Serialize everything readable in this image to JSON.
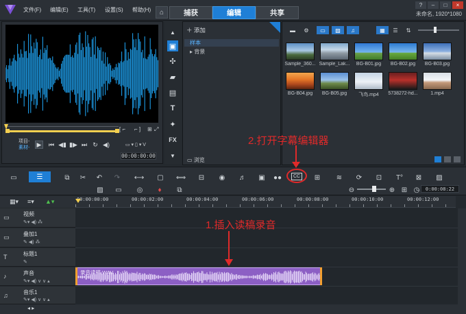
{
  "menu": {
    "items": [
      "文件(F)",
      "编辑(E)",
      "工具(T)",
      "设置(S)",
      "帮助(H)"
    ]
  },
  "tabs": {
    "capture": "捕获",
    "edit": "编辑",
    "share": "共享"
  },
  "project_info": "未命名, 1920*1080",
  "player": {
    "project_label": "项目-",
    "clip_label": "素材-",
    "timecode": "00:00:00:00"
  },
  "library": {
    "add_label": "添加",
    "folders": [
      "样本",
      "背景"
    ],
    "browse_label": "浏览"
  },
  "media": {
    "row1": [
      "Sample_360...",
      "Sample_Lak...",
      "BG-B01.jpg",
      "BG-B02.jpg",
      "BG-B03.jpg"
    ],
    "row2": [
      "BG-B04.jpg",
      "BG-B05.jpg",
      "飞鸟.mp4",
      "5738272-hd...",
      "1.mp4"
    ]
  },
  "timeline": {
    "timecode": "0:00:08:22",
    "ruler_ticks": [
      "00:00:00:00",
      "00:00:02:00",
      "00:00:04:00",
      "00:00:06:00",
      "00:00:08:00",
      "00:00:10:00",
      "00:00:12:00"
    ],
    "tracks": [
      "视频",
      "叠加1",
      "标题1",
      "声音",
      "音乐1"
    ],
    "audio_clip_name": "录音读稿.WAV"
  },
  "annotations": {
    "step1": "1.插入读稿录音",
    "step2": "2.打开字幕编辑器"
  },
  "colors": {
    "accent": "#1f7fd6",
    "waveform": "#1e9be6",
    "audio_clip": "#8c5fc4",
    "annotation": "#e02a2a"
  }
}
